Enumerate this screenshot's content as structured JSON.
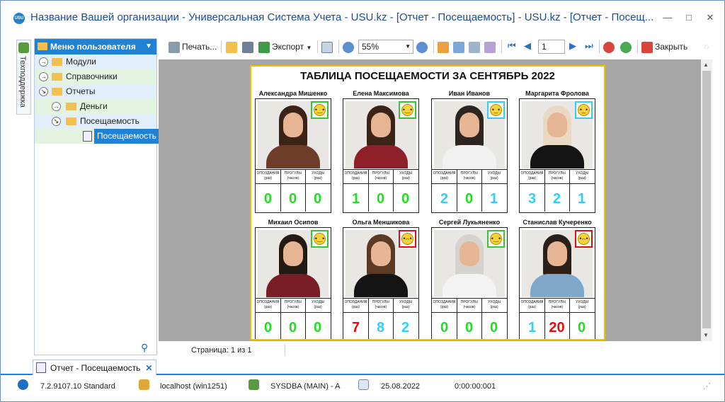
{
  "window": {
    "title": "Название Вашей организации - Универсальная Система Учета - USU.kz - [Отчет - Посещаемость] - USU.kz - [Отчет - Посещ...",
    "logo_text": "USU"
  },
  "side_tab": {
    "label": "Техподдержка"
  },
  "nav": {
    "header": "Меню пользователя",
    "items": [
      {
        "label": "Модули"
      },
      {
        "label": "Справочники"
      },
      {
        "label": "Отчеты"
      },
      {
        "label": "Деньги"
      },
      {
        "label": "Посещаемость"
      },
      {
        "label": "Посещаемость"
      }
    ]
  },
  "toolbar": {
    "print_label": "Печать...",
    "export_label": "Экспорт",
    "zoom_value": "55%",
    "page_value": "1",
    "close_label": "Закрыть"
  },
  "report": {
    "title": "ТАБЛИЦА ПОСЕЩАЕМОСТИ ЗА СЕНТЯБРЬ 2022",
    "stat_headers": [
      {
        "top": "ОПОЗДАНИЯ",
        "sub": "(раз)"
      },
      {
        "top": "ПРОГУЛЫ",
        "sub": "(часов)"
      },
      {
        "top": "УХОДЫ",
        "sub": "(раз)"
      }
    ],
    "employees": [
      {
        "name": "Александра Мишенко",
        "mood": "cool",
        "late": "0",
        "absent": "0",
        "leave": "0",
        "late_color": "#22dd22",
        "absent_color": "#22dd22",
        "leave_color": "#22dd22"
      },
      {
        "name": "Елена Максимова",
        "mood": "cool",
        "late": "1",
        "absent": "0",
        "leave": "0",
        "late_color": "#22dd22",
        "absent_color": "#22dd22",
        "leave_color": "#22dd22"
      },
      {
        "name": "Иван Иванов",
        "mood": "neutral",
        "late": "2",
        "absent": "0",
        "leave": "1",
        "late_color": "#33ccff",
        "absent_color": "#22dd22",
        "leave_color": "#33ccff"
      },
      {
        "name": "Маргарита Фролова",
        "mood": "neutral",
        "late": "3",
        "absent": "2",
        "leave": "1",
        "late_color": "#33ccff",
        "absent_color": "#33ccff",
        "leave_color": "#33ccff"
      },
      {
        "name": "Михаил Осипов",
        "mood": "cool",
        "late": "0",
        "absent": "0",
        "leave": "0",
        "late_color": "#22dd22",
        "absent_color": "#22dd22",
        "leave_color": "#22dd22"
      },
      {
        "name": "Ольга Меншикова",
        "mood": "sad",
        "late": "7",
        "absent": "8",
        "leave": "2",
        "late_color": "#e01010",
        "absent_color": "#33ccff",
        "leave_color": "#33ccff"
      },
      {
        "name": "Сергей Лукьяненко",
        "mood": "cool",
        "late": "0",
        "absent": "0",
        "leave": "0",
        "late_color": "#22dd22",
        "absent_color": "#22dd22",
        "leave_color": "#22dd22"
      },
      {
        "name": "Станислав Кучеренко",
        "mood": "sad",
        "late": "1",
        "absent": "20",
        "leave": "0",
        "late_color": "#33ccff",
        "absent_color": "#e01010",
        "leave_color": "#22dd22"
      }
    ]
  },
  "page_status": "Страница: 1 из 1",
  "tab": {
    "label": "Отчет - Посещаемость"
  },
  "status": {
    "version": "7.2.9107.10 Standard",
    "server": "localhost (win1251)",
    "user": "SYSDBA (MAIN) - A",
    "date": "25.08.2022",
    "timer": "0:00:00:001"
  },
  "colors": {
    "accent": "#1f82d4",
    "mood_cool": "#32c832",
    "mood_neutral": "#33ccff",
    "mood_sad": "#e01010"
  }
}
